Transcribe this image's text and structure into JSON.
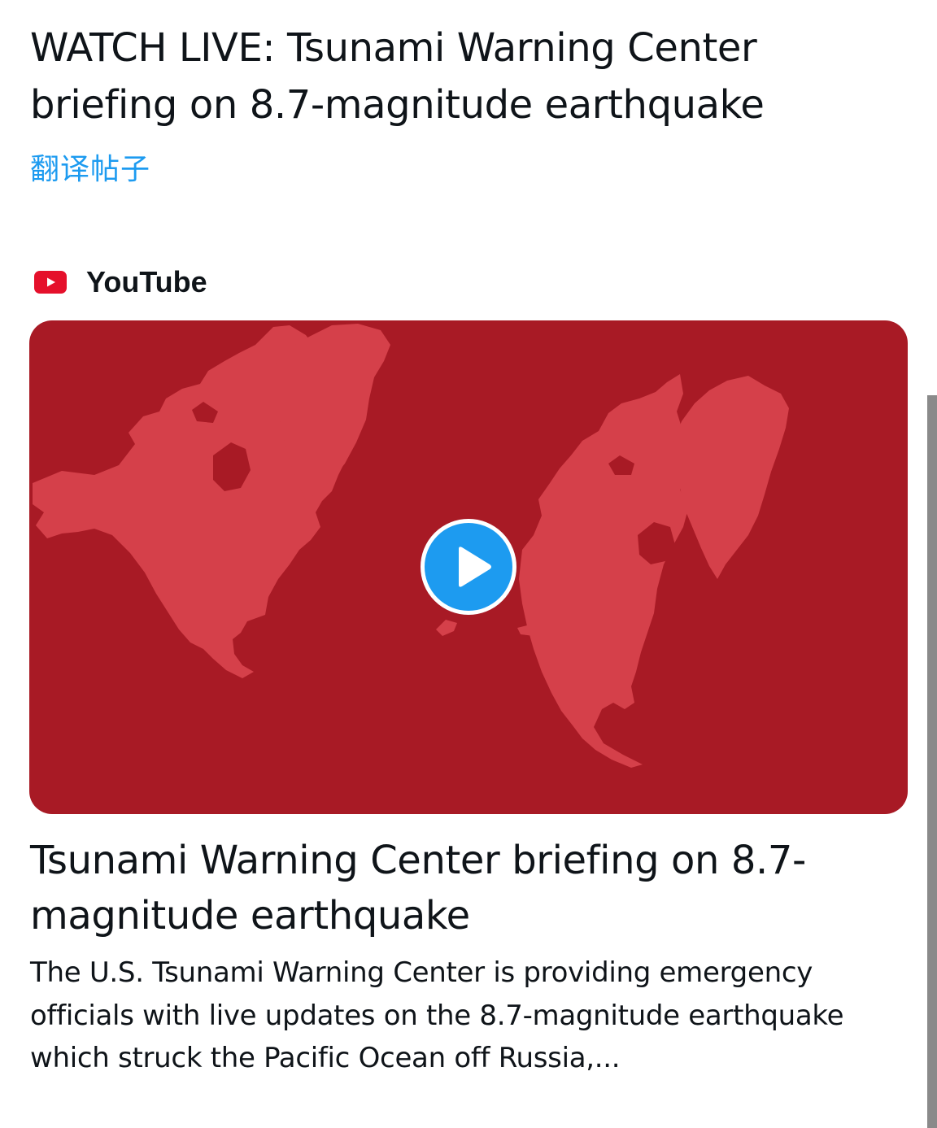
{
  "post": {
    "text": "WATCH LIVE: Tsunami Warning Center briefing on 8.7-magnitude earthquake",
    "translate_label": "翻译帖子"
  },
  "card": {
    "source": "YouTube",
    "title": "Tsunami Warning Center briefing on 8.7-magnitude earthquake",
    "description": "The U.S. Tsunami Warning Center is providing emergency officials with live updates on the 8.7-magnitude earthquake which struck the Pacific Ocean off Russia,...",
    "icons": {
      "source": "youtube-logo-icon",
      "play": "play-icon"
    }
  },
  "colors": {
    "accent": "#1d9bf0",
    "text": "#0f1419",
    "thumbnail_background": "#a81a25",
    "thumbnail_land": "#d5404a",
    "youtube_red": "#e5102b"
  }
}
